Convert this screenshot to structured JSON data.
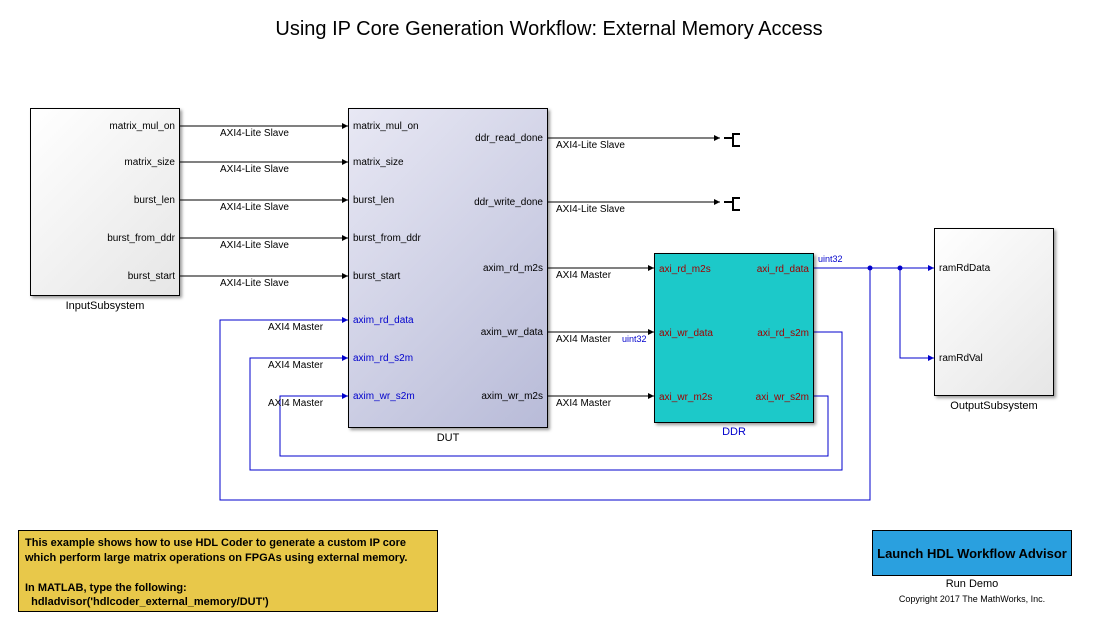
{
  "title": "Using IP Core Generation Workflow: External Memory Access",
  "blocks": {
    "input": {
      "label": "InputSubsystem",
      "outputs": [
        "matrix_mul_on",
        "matrix_size",
        "burst_len",
        "burst_from_ddr",
        "burst_start"
      ]
    },
    "dut": {
      "label": "DUT",
      "inputs": [
        "matrix_mul_on",
        "matrix_size",
        "burst_len",
        "burst_from_ddr",
        "burst_start",
        "axim_rd_data",
        "axim_rd_s2m",
        "axim_wr_s2m"
      ],
      "outputs": [
        "ddr_read_done",
        "ddr_write_done",
        "axim_rd_m2s",
        "axim_wr_data",
        "axim_wr_m2s"
      ]
    },
    "ddr": {
      "label": "DDR",
      "inputs": [
        "axi_rd_m2s",
        "axi_wr_data",
        "axi_wr_m2s"
      ],
      "outputs": [
        "axi_rd_data",
        "axi_rd_s2m",
        "axi_wr_s2m"
      ]
    },
    "output": {
      "label": "OutputSubsystem",
      "inputs": [
        "ramRdData",
        "ramRdVal"
      ]
    }
  },
  "wire_labels": {
    "axi4_lite_slave": "AXI4-Lite Slave",
    "axi4_master": "AXI4 Master",
    "uint32": "uint32"
  },
  "note": {
    "line1": "This example shows how to use HDL Coder to generate a custom IP core",
    "line2": "which perform large matrix operations on FPGAs using external memory.",
    "line3": "In MATLAB, type the following:",
    "line4": "  hdladvisor('hdlcoder_external_memory/DUT')"
  },
  "launch": {
    "label": "Launch HDL Workflow Advisor",
    "sublabel": "Run Demo"
  },
  "copyright": "Copyright 2017 The MathWorks, Inc."
}
